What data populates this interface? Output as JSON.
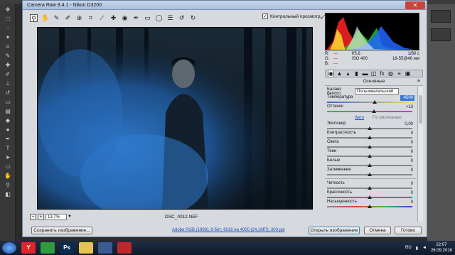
{
  "dialog": {
    "title": "Camera Raw 8.4.1  -  Nikon D3200",
    "preview_label": "Контрольный просмотр",
    "preview_checked": true,
    "toolbar_icons": [
      "zoom-icon",
      "hand-icon",
      "white-balance-icon",
      "color-sampler-icon",
      "targeted-adjustment-icon",
      "crop-icon",
      "straighten-icon",
      "spot-removal-icon",
      "red-eye-icon",
      "adjustment-brush-icon",
      "graduated-filter-icon",
      "radial-filter-icon",
      "preferences-icon",
      "rotate-left-icon",
      "rotate-right-icon"
    ]
  },
  "image": {
    "filename": "DSC_0012.NEF",
    "zoom": "13,7%"
  },
  "info": {
    "r_label": "R:",
    "g_label": "G:",
    "b_label": "B:",
    "rgb_value": "---",
    "aperture": "f/5,6",
    "shutter": "1/80 с",
    "iso": "ISO 400",
    "lens": "18-55@46 мм"
  },
  "panel": {
    "title": "Основные",
    "menu_icon": "≡",
    "wb_label": "Баланс белого:",
    "wb_value": "Пользовательский",
    "auto_link": "Авто",
    "default_link": "По умолчанию",
    "sliders_top": [
      {
        "label": "Температура",
        "value": "4500",
        "pos": 0.56,
        "track": "grad-temp",
        "selected": true
      },
      {
        "label": "Оттенок",
        "value": "+13",
        "pos": 0.55,
        "track": "grad-tint",
        "selected": false
      }
    ],
    "sliders_tone": [
      {
        "label": "Экспонир",
        "value": "0,00",
        "pos": 0.5
      },
      {
        "label": "Контрастность",
        "value": "0",
        "pos": 0.5
      },
      {
        "label": "Света",
        "value": "0",
        "pos": 0.5
      },
      {
        "label": "Тени",
        "value": "0",
        "pos": 0.5
      },
      {
        "label": "Белые",
        "value": "0",
        "pos": 0.5
      },
      {
        "label": "Затемнение",
        "value": "0",
        "pos": 0.5
      }
    ],
    "sliders_presence": [
      {
        "label": "Четкость",
        "value": "0",
        "pos": 0.5,
        "track": ""
      },
      {
        "label": "Красочность",
        "value": "0",
        "pos": 0.5,
        "track": "grad-vib"
      },
      {
        "label": "Насыщенность",
        "value": "0",
        "pos": 0.5,
        "track": "grad-sat"
      }
    ]
  },
  "buttons": {
    "save": "Сохранить изображение...",
    "open": "Открыть изображение",
    "cancel": "Отмена",
    "done": "Готово"
  },
  "workflow_link": "Adobe RGB (1998); 8 бит; 6016 на 4000 (24,1МП); 300 ppi",
  "taskbar": {
    "apps": [
      {
        "label": "Y",
        "color": "#e0262b"
      },
      {
        "label": "",
        "color": "#2e9b3d"
      },
      {
        "label": "Ps",
        "color": "#0b2a4f"
      },
      {
        "label": "",
        "color": "#e7c350"
      },
      {
        "label": "",
        "color": "#3a5a94"
      },
      {
        "label": "",
        "color": "#c0262b"
      }
    ],
    "lang": "RU",
    "time": "22:07",
    "date": "26.09.2016"
  }
}
